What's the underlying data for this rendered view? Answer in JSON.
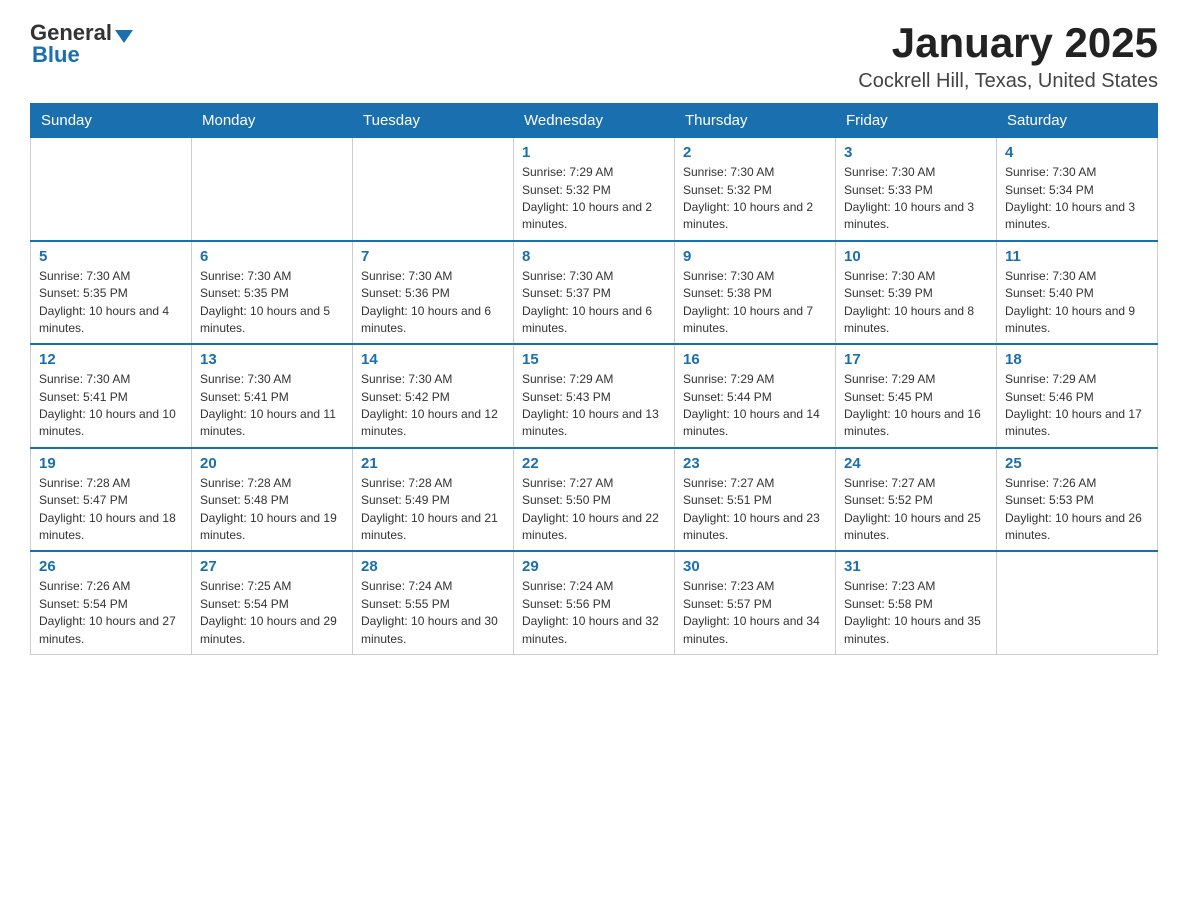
{
  "header": {
    "logo": {
      "general": "General",
      "arrow": "▼",
      "blue": "Blue"
    },
    "title": "January 2025",
    "subtitle": "Cockrell Hill, Texas, United States"
  },
  "calendar": {
    "days_of_week": [
      "Sunday",
      "Monday",
      "Tuesday",
      "Wednesday",
      "Thursday",
      "Friday",
      "Saturday"
    ],
    "weeks": [
      [
        {
          "day": "",
          "details": ""
        },
        {
          "day": "",
          "details": ""
        },
        {
          "day": "",
          "details": ""
        },
        {
          "day": "1",
          "details": "Sunrise: 7:29 AM\nSunset: 5:32 PM\nDaylight: 10 hours and 2 minutes."
        },
        {
          "day": "2",
          "details": "Sunrise: 7:30 AM\nSunset: 5:32 PM\nDaylight: 10 hours and 2 minutes."
        },
        {
          "day": "3",
          "details": "Sunrise: 7:30 AM\nSunset: 5:33 PM\nDaylight: 10 hours and 3 minutes."
        },
        {
          "day": "4",
          "details": "Sunrise: 7:30 AM\nSunset: 5:34 PM\nDaylight: 10 hours and 3 minutes."
        }
      ],
      [
        {
          "day": "5",
          "details": "Sunrise: 7:30 AM\nSunset: 5:35 PM\nDaylight: 10 hours and 4 minutes."
        },
        {
          "day": "6",
          "details": "Sunrise: 7:30 AM\nSunset: 5:35 PM\nDaylight: 10 hours and 5 minutes."
        },
        {
          "day": "7",
          "details": "Sunrise: 7:30 AM\nSunset: 5:36 PM\nDaylight: 10 hours and 6 minutes."
        },
        {
          "day": "8",
          "details": "Sunrise: 7:30 AM\nSunset: 5:37 PM\nDaylight: 10 hours and 6 minutes."
        },
        {
          "day": "9",
          "details": "Sunrise: 7:30 AM\nSunset: 5:38 PM\nDaylight: 10 hours and 7 minutes."
        },
        {
          "day": "10",
          "details": "Sunrise: 7:30 AM\nSunset: 5:39 PM\nDaylight: 10 hours and 8 minutes."
        },
        {
          "day": "11",
          "details": "Sunrise: 7:30 AM\nSunset: 5:40 PM\nDaylight: 10 hours and 9 minutes."
        }
      ],
      [
        {
          "day": "12",
          "details": "Sunrise: 7:30 AM\nSunset: 5:41 PM\nDaylight: 10 hours and 10 minutes."
        },
        {
          "day": "13",
          "details": "Sunrise: 7:30 AM\nSunset: 5:41 PM\nDaylight: 10 hours and 11 minutes."
        },
        {
          "day": "14",
          "details": "Sunrise: 7:30 AM\nSunset: 5:42 PM\nDaylight: 10 hours and 12 minutes."
        },
        {
          "day": "15",
          "details": "Sunrise: 7:29 AM\nSunset: 5:43 PM\nDaylight: 10 hours and 13 minutes."
        },
        {
          "day": "16",
          "details": "Sunrise: 7:29 AM\nSunset: 5:44 PM\nDaylight: 10 hours and 14 minutes."
        },
        {
          "day": "17",
          "details": "Sunrise: 7:29 AM\nSunset: 5:45 PM\nDaylight: 10 hours and 16 minutes."
        },
        {
          "day": "18",
          "details": "Sunrise: 7:29 AM\nSunset: 5:46 PM\nDaylight: 10 hours and 17 minutes."
        }
      ],
      [
        {
          "day": "19",
          "details": "Sunrise: 7:28 AM\nSunset: 5:47 PM\nDaylight: 10 hours and 18 minutes."
        },
        {
          "day": "20",
          "details": "Sunrise: 7:28 AM\nSunset: 5:48 PM\nDaylight: 10 hours and 19 minutes."
        },
        {
          "day": "21",
          "details": "Sunrise: 7:28 AM\nSunset: 5:49 PM\nDaylight: 10 hours and 21 minutes."
        },
        {
          "day": "22",
          "details": "Sunrise: 7:27 AM\nSunset: 5:50 PM\nDaylight: 10 hours and 22 minutes."
        },
        {
          "day": "23",
          "details": "Sunrise: 7:27 AM\nSunset: 5:51 PM\nDaylight: 10 hours and 23 minutes."
        },
        {
          "day": "24",
          "details": "Sunrise: 7:27 AM\nSunset: 5:52 PM\nDaylight: 10 hours and 25 minutes."
        },
        {
          "day": "25",
          "details": "Sunrise: 7:26 AM\nSunset: 5:53 PM\nDaylight: 10 hours and 26 minutes."
        }
      ],
      [
        {
          "day": "26",
          "details": "Sunrise: 7:26 AM\nSunset: 5:54 PM\nDaylight: 10 hours and 27 minutes."
        },
        {
          "day": "27",
          "details": "Sunrise: 7:25 AM\nSunset: 5:54 PM\nDaylight: 10 hours and 29 minutes."
        },
        {
          "day": "28",
          "details": "Sunrise: 7:24 AM\nSunset: 5:55 PM\nDaylight: 10 hours and 30 minutes."
        },
        {
          "day": "29",
          "details": "Sunrise: 7:24 AM\nSunset: 5:56 PM\nDaylight: 10 hours and 32 minutes."
        },
        {
          "day": "30",
          "details": "Sunrise: 7:23 AM\nSunset: 5:57 PM\nDaylight: 10 hours and 34 minutes."
        },
        {
          "day": "31",
          "details": "Sunrise: 7:23 AM\nSunset: 5:58 PM\nDaylight: 10 hours and 35 minutes."
        },
        {
          "day": "",
          "details": ""
        }
      ]
    ]
  }
}
